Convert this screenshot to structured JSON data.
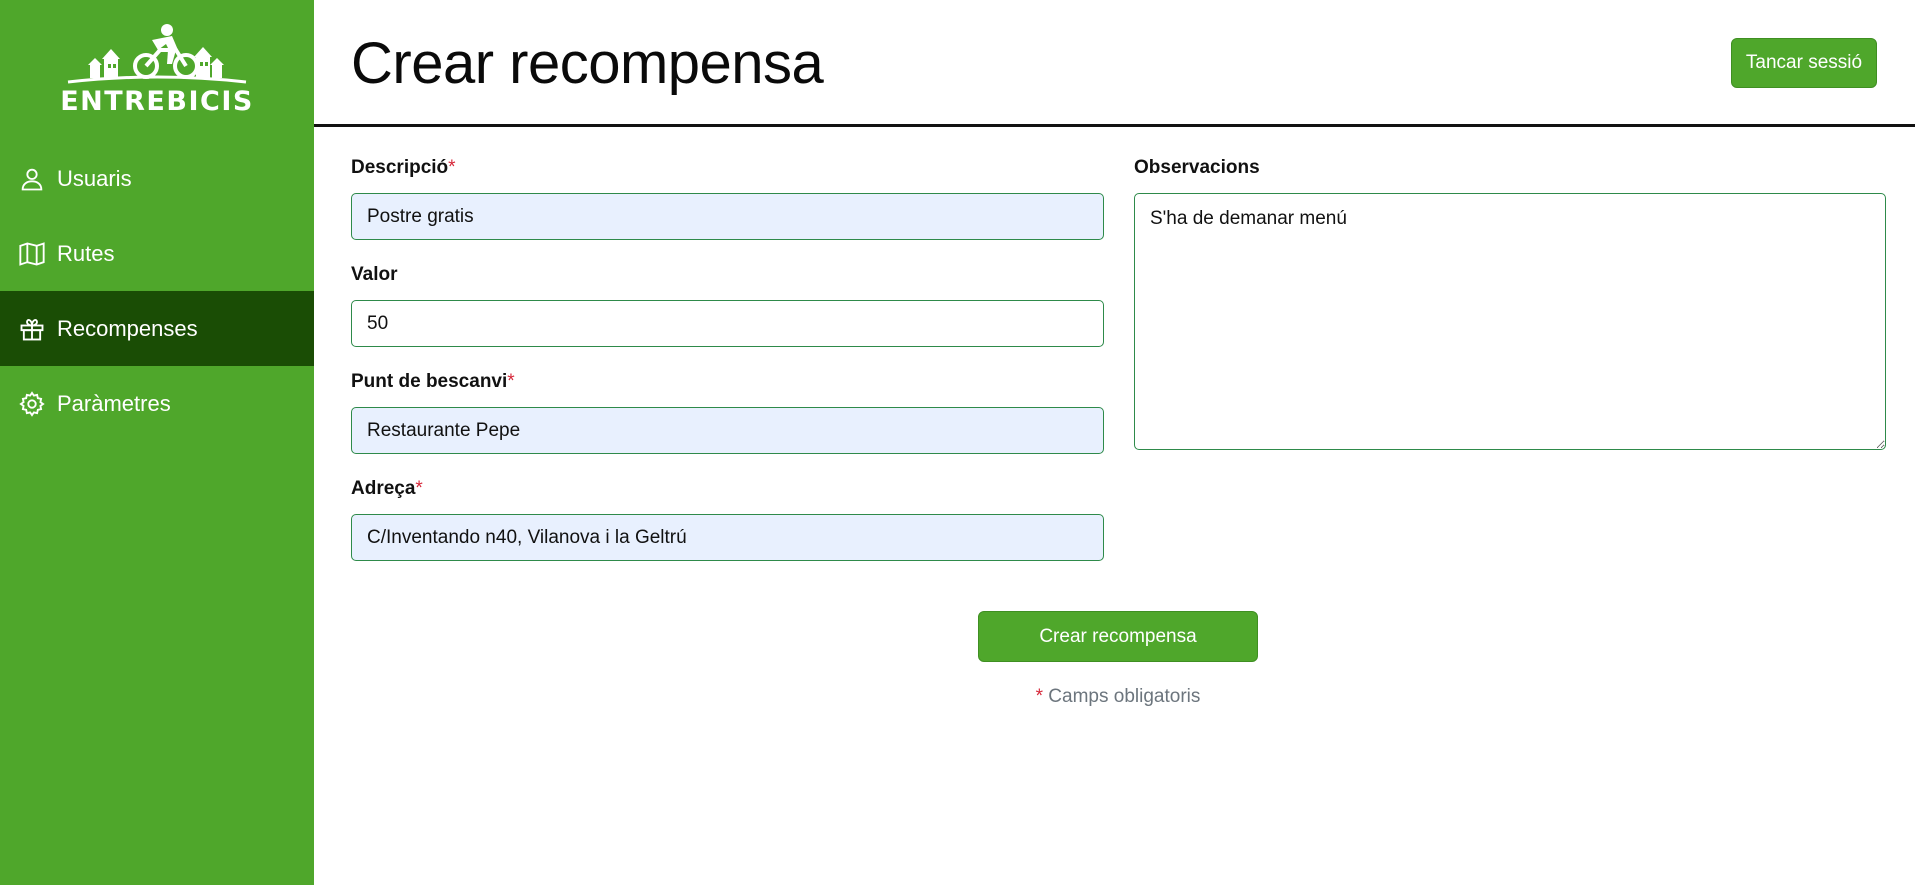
{
  "brand": {
    "name": "ENTREBICIS"
  },
  "sidebar": {
    "items": [
      {
        "label": "Usuaris",
        "icon": "user-icon",
        "active": false
      },
      {
        "label": "Rutes",
        "icon": "map-icon",
        "active": false
      },
      {
        "label": "Recompenses",
        "icon": "gift-icon",
        "active": true
      },
      {
        "label": "Paràmetres",
        "icon": "gear-icon",
        "active": false
      }
    ]
  },
  "header": {
    "title": "Crear recompensa",
    "logout_label": "Tancar sessió"
  },
  "form": {
    "required_marker": "*",
    "descripcio": {
      "label": "Descripció",
      "value": "Postre gratis",
      "required": true
    },
    "valor": {
      "label": "Valor",
      "value": "50",
      "required": false
    },
    "punt": {
      "label": "Punt de bescanvi",
      "value": "Restaurante Pepe",
      "required": true
    },
    "adreca": {
      "label": "Adreça",
      "value": "C/Inventando n40, Vilanova i la Geltrú",
      "required": true
    },
    "observacions": {
      "label": "Observacions",
      "value": "S'ha de demanar menú",
      "required": false
    },
    "submit_label": "Crear recompensa",
    "required_note": "Camps obligatoris"
  },
  "colors": {
    "sidebar_bg": "#4fa72b",
    "sidebar_active": "#1a4d05",
    "input_border": "#2e8a4a",
    "autofill_bg": "#e8f0fe",
    "required": "#d6283a"
  }
}
